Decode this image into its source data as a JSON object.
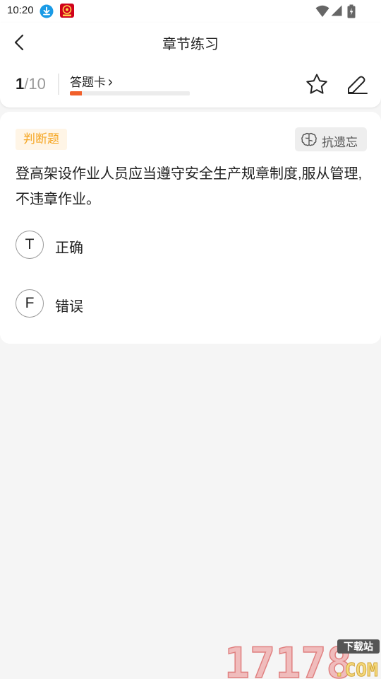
{
  "status_bar": {
    "time": "10:20"
  },
  "header": {
    "title": "章节练习",
    "progress_current": "1",
    "progress_total": "/10",
    "progress_fraction": 0.1,
    "answer_card_label": "答题卡",
    "answer_card_chevron": "›"
  },
  "question": {
    "type_label": "判断题",
    "memory_label": "抗遗忘",
    "text": "登高架设作业人员应当遵守安全生产规章制度,服从管理,不违章作业。",
    "options": [
      {
        "key": "T",
        "label": "正确"
      },
      {
        "key": "F",
        "label": "错误"
      }
    ]
  },
  "watermark": {
    "number": "17178",
    "tag": "下载站",
    "domain": ".COM"
  },
  "colors": {
    "accent": "#f1602b",
    "badge_text": "#f5a623",
    "badge_bg": "#fff5e6",
    "download_icon": "#1a9be6",
    "app_icon": "#d0021b"
  }
}
